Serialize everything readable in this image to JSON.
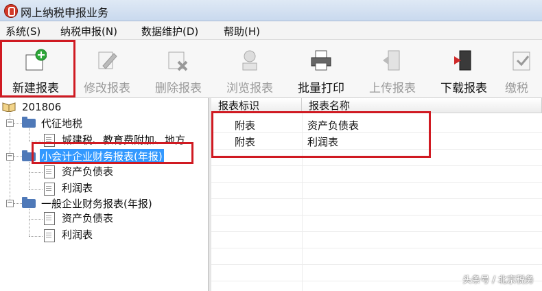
{
  "window": {
    "title": "网上纳税申报业务"
  },
  "menu": [
    {
      "label": "系统(S)"
    },
    {
      "label": "纳税申报(N)"
    },
    {
      "label": "数据维护(D)"
    },
    {
      "label": "帮助(H)"
    }
  ],
  "toolbar": [
    {
      "label": "新建报表",
      "icon": "new-report-icon",
      "enabled": true
    },
    {
      "label": "修改报表",
      "icon": "edit-report-icon",
      "enabled": false
    },
    {
      "label": "删除报表",
      "icon": "delete-report-icon",
      "enabled": false
    },
    {
      "label": "浏览报表",
      "icon": "browse-report-icon",
      "enabled": false
    },
    {
      "label": "批量打印",
      "icon": "printer-icon",
      "enabled": true
    },
    {
      "label": "上传报表",
      "icon": "upload-icon",
      "enabled": false
    },
    {
      "label": "下载报表",
      "icon": "download-icon",
      "enabled": true
    },
    {
      "label": "缴税",
      "icon": "pay-tax-icon",
      "enabled": false
    }
  ],
  "tree": {
    "root": "201806",
    "nodes": [
      {
        "label": "代征地税",
        "children": [
          "城建税、教育费附加、地方"
        ]
      },
      {
        "label": "小会计企业财务报表(年报)",
        "selected": true,
        "children": [
          "资产负债表",
          "利润表"
        ]
      },
      {
        "label": "一般企业财务报表(年报)",
        "children": [
          "资产负债表",
          "利润表"
        ]
      }
    ]
  },
  "grid": {
    "columns": [
      "报表标识",
      "报表名称"
    ],
    "rows": [
      [
        "附表",
        "资产负债表"
      ],
      [
        "附表",
        "利润表"
      ]
    ]
  },
  "watermark": "头条号 / 北京税务",
  "colors": {
    "highlight": "#d01a22",
    "selection": "#3399ff"
  }
}
